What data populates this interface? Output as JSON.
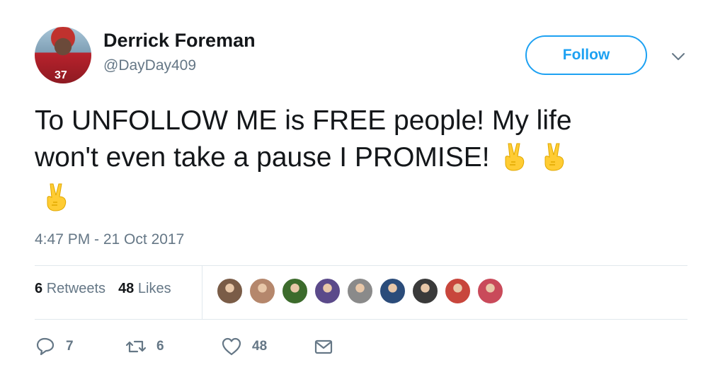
{
  "author": {
    "display_name": "Derrick Foreman",
    "handle": "@DayDay409",
    "avatar_icon": "profile-avatar-icon",
    "avatar_jersey_text": "37"
  },
  "follow_button": {
    "label": "Follow",
    "color": "#1da1f2"
  },
  "menu_icon": "chevron-down-icon",
  "tweet": {
    "line1": "To UNFOLLOW ME is FREE people! My life",
    "line2": "won't even take a pause I PROMISE!",
    "emoji": "victory-hand-emoji",
    "emoji_count": 3
  },
  "timestamp": "4:47 PM - 21 Oct 2017",
  "stats": {
    "retweets_count": "6",
    "retweets_label": "Retweets",
    "likes_count": "48",
    "likes_label": "Likes"
  },
  "likers": [
    {
      "name": "liker-avatar",
      "color": "#7a5c47"
    },
    {
      "name": "liker-avatar",
      "color": "#b5876c"
    },
    {
      "name": "liker-avatar",
      "color": "#3c6b2c"
    },
    {
      "name": "liker-avatar",
      "color": "#5b4a8a"
    },
    {
      "name": "liker-avatar",
      "color": "#8a8a8a"
    },
    {
      "name": "liker-avatar",
      "color": "#2b4c7a"
    },
    {
      "name": "liker-avatar",
      "color": "#3a3a3a"
    },
    {
      "name": "liker-avatar",
      "color": "#c8463c"
    },
    {
      "name": "liker-avatar",
      "color": "#c94a5a"
    }
  ],
  "actions": {
    "reply_icon": "reply-icon",
    "reply_count": "7",
    "retweet_icon": "retweet-icon",
    "retweet_count": "6",
    "like_icon": "heart-icon",
    "like_count": "48",
    "dm_icon": "envelope-icon"
  },
  "colors": {
    "accent": "#1da1f2",
    "secondary_text": "#657786",
    "primary_text": "#14171a",
    "divider": "#e1e8ed"
  }
}
